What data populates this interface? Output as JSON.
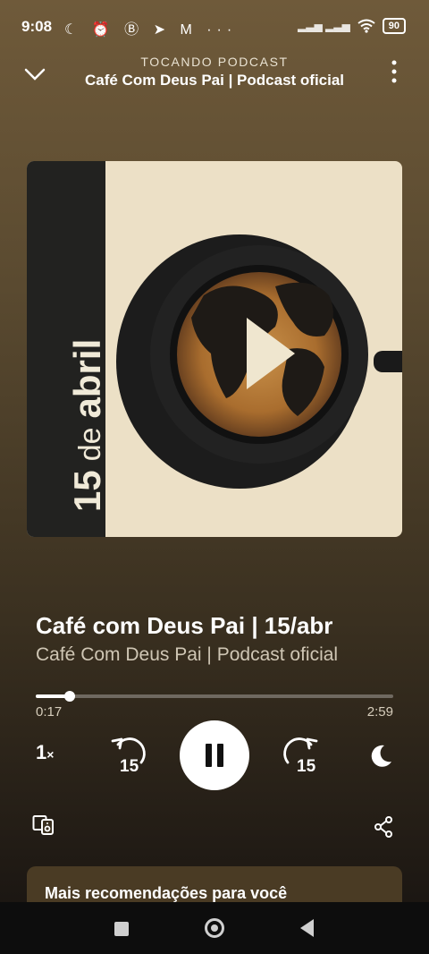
{
  "status_bar": {
    "time": "9:08",
    "left_icons": [
      "moon-icon",
      "alarm-icon",
      "b-app-icon",
      "telegram-icon",
      "gmail-icon",
      "more-dots"
    ],
    "battery": "90"
  },
  "header": {
    "subtitle": "TOCANDO PODCAST",
    "title": "Café Com Deus Pai | Podcast oficial"
  },
  "cover": {
    "day": "15",
    "de": "de",
    "month": "abril"
  },
  "track": {
    "title": "Café com Deus Pai | 15/abr",
    "show": "Café Com Deus Pai | Podcast oficial"
  },
  "playback": {
    "current_time": "0:17",
    "total_time": "2:59",
    "progress_fraction": 0.095,
    "speed_num": "1",
    "speed_x": "×",
    "skip_back": "15",
    "skip_forward": "15"
  },
  "recommendations": {
    "title": "Mais recomendações para você"
  },
  "colors": {
    "accent": "#ffffff",
    "cover_bg": "#ece0c6",
    "cover_band": "#222220"
  }
}
